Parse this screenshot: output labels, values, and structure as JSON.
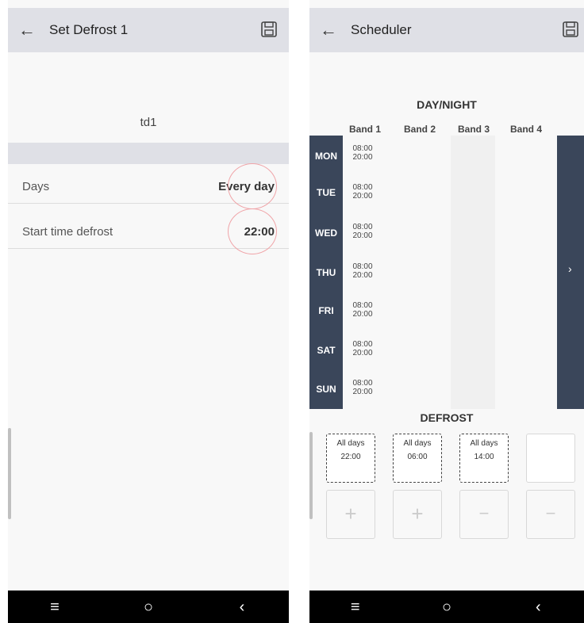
{
  "left": {
    "title": "Set Defrost 1",
    "back_icon": "back-arrow-icon",
    "save_icon": "save-floppy-icon",
    "device_name": "td1",
    "rows": [
      {
        "label": "Days",
        "value": "Every day"
      },
      {
        "label": "Start time defrost",
        "value": "22:00"
      }
    ],
    "nav": {
      "menu": "≡",
      "home": "○",
      "back": "‹"
    }
  },
  "right": {
    "title": "Scheduler",
    "back_icon": "back-arrow-icon",
    "save_icon": "save-floppy-icon",
    "section_day_night": "DAY/NIGHT",
    "bands": [
      "Band 1",
      "Band 2",
      "Band 3",
      "Band 4"
    ],
    "days": [
      {
        "day": "MON",
        "start": "08:00",
        "end": "20:00"
      },
      {
        "day": "TUE",
        "start": "08:00",
        "end": "20:00"
      },
      {
        "day": "WED",
        "start": "08:00",
        "end": "20:00"
      },
      {
        "day": "THU",
        "start": "08:00",
        "end": "20:00"
      },
      {
        "day": "FRI",
        "start": "08:00",
        "end": "20:00"
      },
      {
        "day": "SAT",
        "start": "08:00",
        "end": "20:00"
      },
      {
        "day": "SUN",
        "start": "08:00",
        "end": "20:00"
      }
    ],
    "next_icon": "›",
    "section_defrost": "DEFROST",
    "defrosts": [
      {
        "days": "All days",
        "time": "22:00"
      },
      {
        "days": "All days",
        "time": "06:00"
      },
      {
        "days": "All days",
        "time": "14:00"
      }
    ],
    "add_label": "+",
    "remove_label": "−",
    "nav": {
      "menu": "≡",
      "home": "○",
      "back": "‹"
    }
  },
  "colors": {
    "appbar": "#dfe0e6",
    "dark_panel": "#3a465a",
    "highlight": "#f0a4a8",
    "navbar": "#000000"
  }
}
